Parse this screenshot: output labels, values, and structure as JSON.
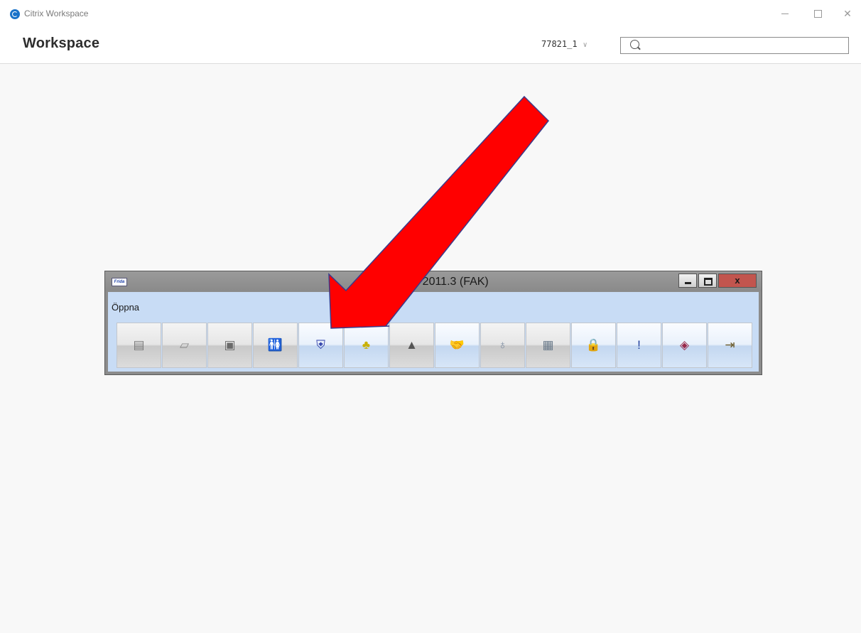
{
  "window": {
    "app_title": "Citrix Workspace",
    "accent": "#1a73c9"
  },
  "header": {
    "title": "Workspace",
    "account": "77821_1",
    "search_placeholder": ""
  },
  "frida": {
    "caption": "ver 2011.3    (FAK)",
    "logo_text": "Frida",
    "close_label": "x",
    "menu_open": "Öppna",
    "toolbar": [
      {
        "icon": "calculator-icon",
        "glyph": "▤",
        "color": "#7a7a7a",
        "style": "grey"
      },
      {
        "icon": "documents-icon",
        "glyph": "▱",
        "color": "#8a8a8a",
        "style": "grey"
      },
      {
        "icon": "folder-icon",
        "glyph": "▣",
        "color": "#6a6a6a",
        "style": "grey"
      },
      {
        "icon": "people-icon",
        "glyph": "🚻",
        "color": "#666666",
        "style": "grey"
      },
      {
        "icon": "shield-icon",
        "glyph": "⛨",
        "color": "#2a3aa8",
        "style": "blue"
      },
      {
        "icon": "bee-icon",
        "glyph": "♣",
        "color": "#c9b000",
        "style": "blue"
      },
      {
        "icon": "graduation-cap-icon",
        "glyph": "▲",
        "color": "#555555",
        "style": "grey"
      },
      {
        "icon": "handshake-icon",
        "glyph": "🤝",
        "color": "#a66a3a",
        "style": "blue"
      },
      {
        "icon": "medal-icon",
        "glyph": "♁",
        "color": "#7a8aa0",
        "style": "grey"
      },
      {
        "icon": "card-icon",
        "glyph": "▦",
        "color": "#6a7a8a",
        "style": "grey"
      },
      {
        "icon": "lock-icon",
        "glyph": "🔒",
        "color": "#2a9a60",
        "style": "blue"
      },
      {
        "icon": "exclamation-icon",
        "glyph": "!",
        "color": "#1a3a9a",
        "style": "blue"
      },
      {
        "icon": "book-icon",
        "glyph": "◈",
        "color": "#9a2a4a",
        "style": "blue"
      },
      {
        "icon": "exit-door-icon",
        "glyph": "⇥",
        "color": "#6a5a2a",
        "style": "blue"
      }
    ]
  },
  "annotation": {
    "arrow_color": "#ff0000"
  }
}
